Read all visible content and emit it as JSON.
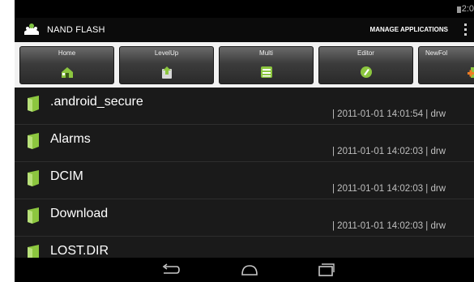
{
  "status_bar": {
    "clock": "2:0"
  },
  "action_bar": {
    "title": "NAND FLASH",
    "manage_applications": "MANAGE APPLICATIONS"
  },
  "toolbar": {
    "buttons": [
      {
        "label": "Home",
        "icon": "home-icon"
      },
      {
        "label": "LevelUp",
        "icon": "level-up-icon"
      },
      {
        "label": "Multi",
        "icon": "multi-select-icon"
      },
      {
        "label": "Editor",
        "icon": "editor-icon"
      },
      {
        "label": "NewFol",
        "icon": "new-folder-icon"
      }
    ]
  },
  "files": [
    {
      "name": ".android_secure",
      "meta": "| 2011-01-01 14:01:54 | drw"
    },
    {
      "name": "Alarms",
      "meta": "| 2011-01-01 14:02:03 | drw"
    },
    {
      "name": "DCIM",
      "meta": "| 2011-01-01 14:02:03 | drw"
    },
    {
      "name": "Download",
      "meta": "| 2011-01-01 14:02:03 | drw"
    },
    {
      "name": "LOST.DIR",
      "meta": ""
    }
  ],
  "nav_bar": {
    "icons": [
      "back-icon",
      "home-nav-icon",
      "recents-icon"
    ]
  },
  "colors": {
    "list_background": "#1a1a1a",
    "folder_green": "#8cc63f",
    "toolbar_background": "#f2f2f2"
  }
}
